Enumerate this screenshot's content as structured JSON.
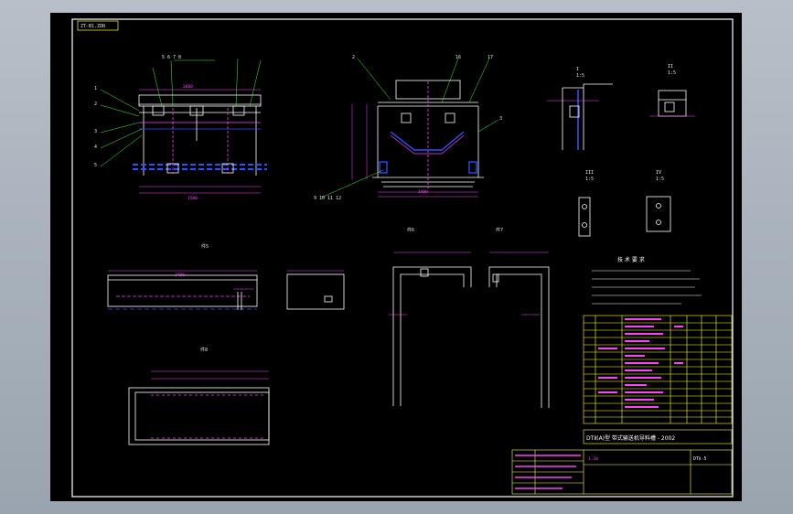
{
  "drawing": {
    "tag_label": "ZT-B1.ZDR",
    "title_block": {
      "drawing_title": "DTⅡ(A)型 带式输送机导料槽 - 2002",
      "drawing_number": "DTⅡ-5",
      "scale_note": "1:20"
    },
    "views": {
      "plan_view": "A-A",
      "section_b": "B-B",
      "detail_1": "I",
      "detail_2": "II",
      "detail_3": "III",
      "detail_4": "IV",
      "part_a": "件5",
      "part_b": "件6",
      "part_c": "件7",
      "part_d": "件8"
    },
    "notes_heading": "技 术 要 求"
  },
  "colors": {
    "background": "#000000",
    "frame": "#ffffff",
    "outline": "#ffffff",
    "dimension": "#ff40ff",
    "centerline": "#3050ff",
    "title_block": "#ffff40",
    "leader": "#40ff40"
  }
}
